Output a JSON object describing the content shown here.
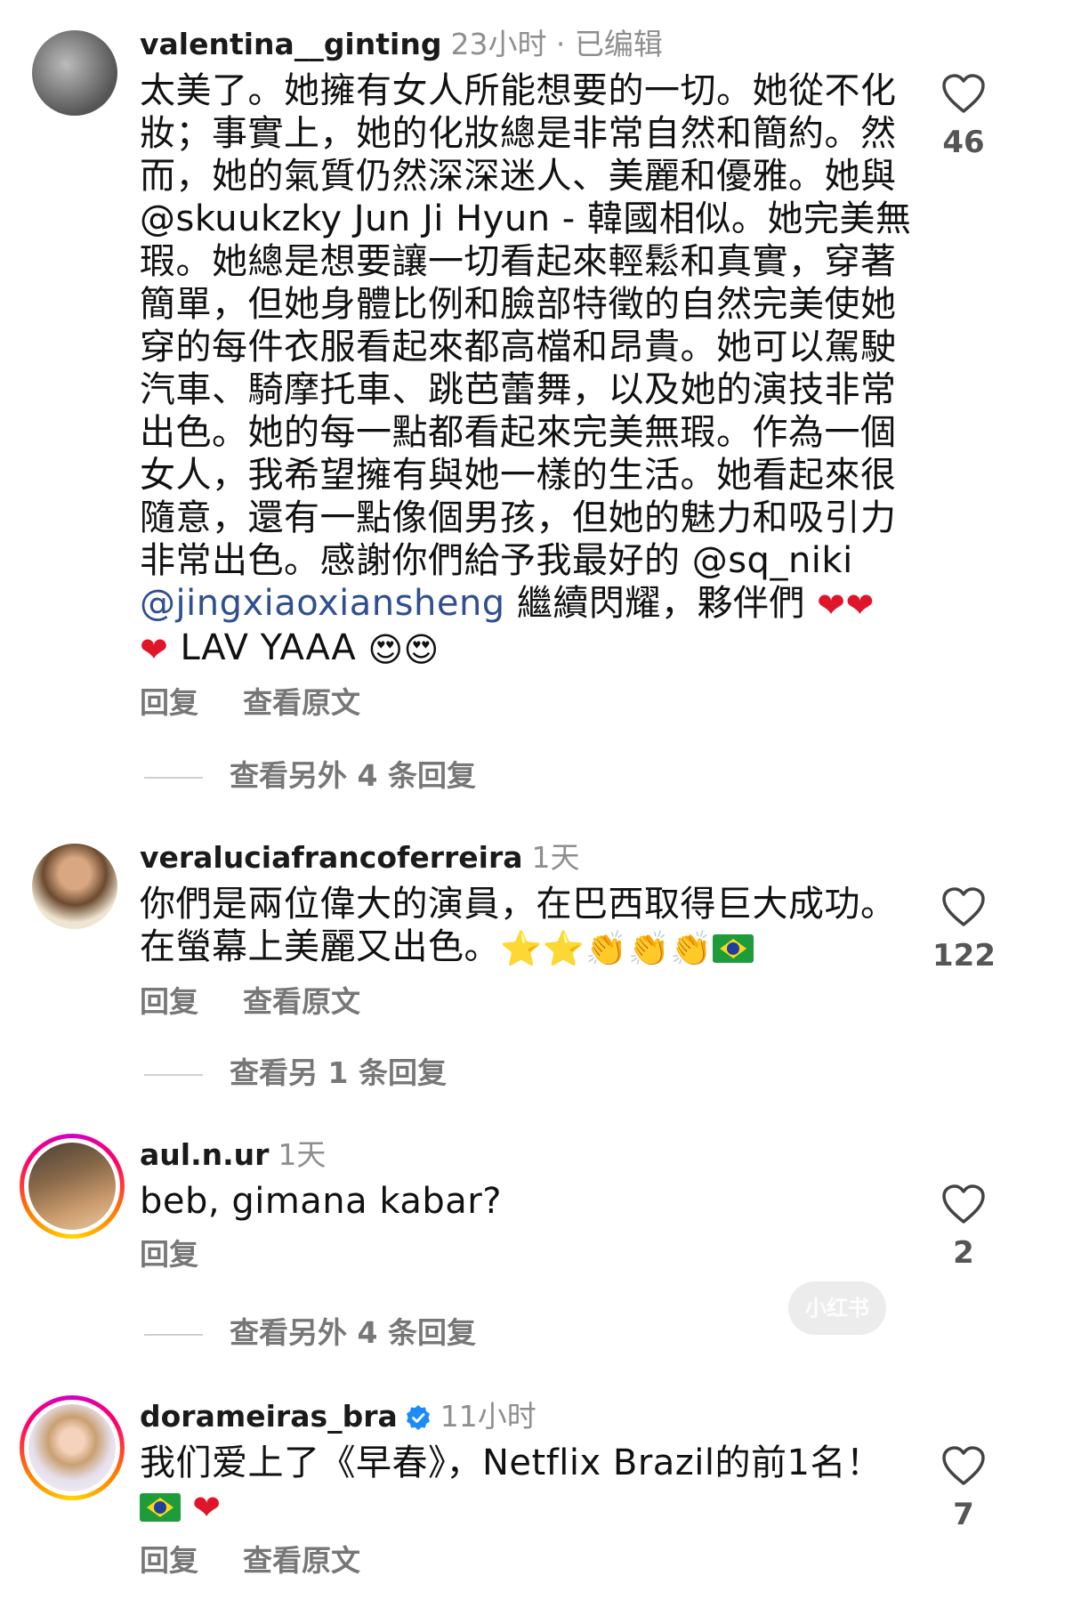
{
  "comments": [
    {
      "username": "valentina__ginting",
      "meta": "23小时 · 已编辑",
      "text_1": "太美了。她擁有女人所能想要的一切。她從不化妝；事實上，她的化妝總是非常自然和簡約。然而，她的氣質仍然深深迷人、美麗和優雅。她與@skuukzky Jun Ji Hyun - 韓國相似。她完美無瑕。她總是想要讓一切看起來輕鬆和真實，穿著簡單，但她身體比例和臉部特徵的自然完美使她穿的每件衣服看起來都高檔和昂貴。她可以駕駛汽車、騎摩托車、跳芭蕾舞，以及她的演技非常出色。她的每一點都看起來完美無瑕。作為一個女人，我希望擁有與她一樣的生活。她看起來很隨意，還有一點像個男孩，但她的魅力和吸引力非常出色。感謝你們給予我最好的 @sq_niki",
      "mention": "@jingxiaoxiansheng",
      "text_2": " 繼續閃耀，夥伴們 ",
      "text_3": " LAV YAAA ",
      "reply_label": "回复",
      "translate_label": "查看原文",
      "like_count": "46",
      "replies_toggle": "查看另外 4 条回复"
    },
    {
      "username": "veraluciafrancoferreira",
      "meta": "1天",
      "text_1": "你們是兩位偉大的演員，在巴西取得巨大成功。在螢幕上美麗又出色。",
      "reply_label": "回复",
      "translate_label": "查看原文",
      "like_count": "122",
      "replies_toggle": "查看另 1 条回复"
    },
    {
      "username": "aul.n.ur",
      "meta": "1天",
      "text_1": "beb, gimana kabar?",
      "reply_label": "回复",
      "like_count": "2",
      "replies_toggle": "查看另外 4 条回复"
    },
    {
      "username": "dorameiras_bra",
      "meta": "11小时",
      "text_1": "我们爱上了《早春》，Netflix Brazil的前1名！",
      "reply_label": "回复",
      "translate_label": "查看原文",
      "like_count": "7"
    }
  ],
  "emoji": {
    "heart": "❤",
    "heart_eyes": "😍",
    "star": "⭐",
    "clap": "👏"
  },
  "watermark": "小红书",
  "icons": {
    "like": "heart-outline-icon",
    "verified": "verified-badge-icon"
  },
  "colors": {
    "mention": "#2f4f8f",
    "heart": "#e0152a",
    "meta": "#8e8e8e",
    "verified": "#1d8cf8"
  }
}
